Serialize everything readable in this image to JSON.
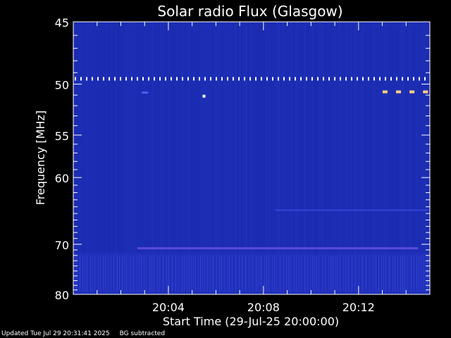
{
  "chart_data": {
    "type": "heatmap",
    "title": "Solar radio Flux (Glasgow)",
    "xlabel": "Start Time (29-Jul-25 20:00:00)",
    "ylabel": "Frequency [MHz]",
    "x_range_minutes": [
      0,
      15
    ],
    "x_ticks": [
      {
        "minute": 4,
        "label": "20:04"
      },
      {
        "minute": 8,
        "label": "20:08"
      },
      {
        "minute": 12,
        "label": "20:12"
      }
    ],
    "y_range_mhz": [
      45,
      80
    ],
    "y_scale": "reciprocal",
    "y_ticks": [
      {
        "value": 45,
        "label": "45"
      },
      {
        "value": 50,
        "label": "50"
      },
      {
        "value": 55,
        "label": "55"
      },
      {
        "value": 60,
        "label": "60"
      },
      {
        "value": 70,
        "label": "70"
      },
      {
        "value": 80,
        "label": "80"
      }
    ],
    "background_color": "#1c2db4",
    "features": [
      {
        "name": "periodic-interference-line",
        "freq_mhz": 49.5,
        "minute_start": 0,
        "minute_end": 15,
        "color": "#ffffff"
      },
      {
        "name": "blob",
        "freq_mhz": 50.8,
        "minute": 3.0,
        "color": "#4b5cf0"
      },
      {
        "name": "spot",
        "freq_mhz": 51.1,
        "minute": 5.5,
        "color": "#ffffff"
      },
      {
        "name": "bright-pulses",
        "freq_mhz": 50.7,
        "minute_start": 13.1,
        "minute_end": 14.8,
        "color": "#ffd080"
      },
      {
        "name": "faint-band",
        "freq_mhz": 64.5,
        "minute_start": 8.5,
        "minute_end": 15,
        "color": "#3344d8"
      },
      {
        "name": "band",
        "freq_mhz": 70.7,
        "minute_start": 2.7,
        "minute_end": 14.5,
        "color": "#5a4ad8"
      },
      {
        "name": "lower-noise-region",
        "freq_mhz_start": 71.5,
        "freq_mhz_end": 80,
        "color": "#2536c4"
      }
    ]
  },
  "footer": {
    "updated": "Updated Tue Jul 29 20:31:41 2025",
    "note": "BG subtracted"
  }
}
